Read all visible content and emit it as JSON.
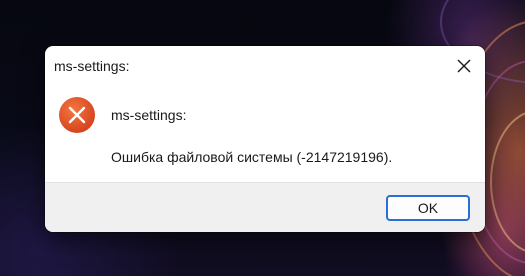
{
  "dialog": {
    "title": "ms-settings:",
    "heading": "ms-settings:",
    "message": "Ошибка файловой системы (-2147219196).",
    "icon": "error-icon",
    "ok_label": "OK",
    "close_icon": "close-icon"
  },
  "colors": {
    "error_red": "#e0502a",
    "focus_blue": "#2a6fd6",
    "footer_gray": "#f0f0f0"
  }
}
